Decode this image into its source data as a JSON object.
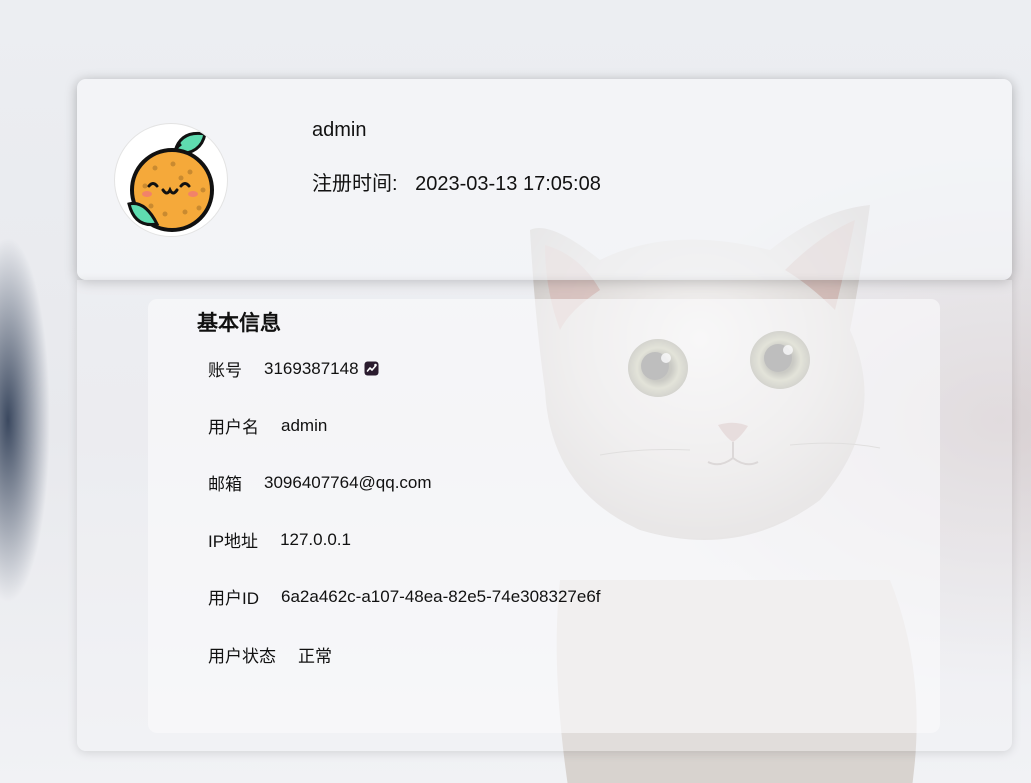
{
  "profile": {
    "username": "admin",
    "register_label": "注册时间:",
    "register_time": "2023-03-13 17:05:08",
    "avatar_icon": "orange-mascot-icon"
  },
  "info": {
    "title": "基本信息",
    "rows": [
      {
        "key": "账号",
        "value": "3169387148",
        "icon": "qq-brand-icon"
      },
      {
        "key": "用户名",
        "value": "admin"
      },
      {
        "key": "邮箱",
        "value": "3096407764@qq.com"
      },
      {
        "key": "IP地址",
        "value": "127.0.0.1"
      },
      {
        "key": "用户ID",
        "value": "6a2a462c-a107-48ea-82e5-74e308327e6f"
      },
      {
        "key": "用户状态",
        "value": "正常"
      }
    ]
  },
  "colors": {
    "orange": "#f5a93a",
    "leaf": "#5fdcb0",
    "outline": "#111111"
  }
}
